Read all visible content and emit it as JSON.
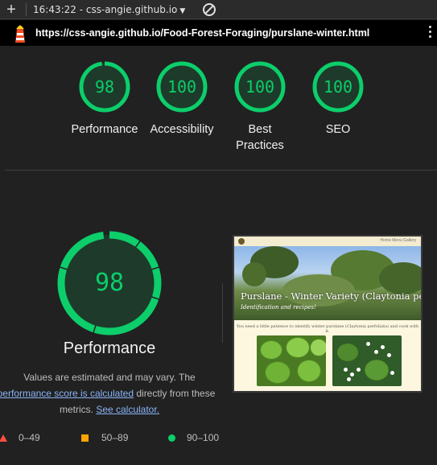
{
  "toolbar": {
    "time": "16:43:22 - css-angie.github.io",
    "caret": "▼"
  },
  "url": "https://css-angie.github.io/Food-Forest-Foraging/purslane-winter.html",
  "scores": [
    {
      "value": "98",
      "label": "Performance",
      "fraction": 0.98
    },
    {
      "value": "100",
      "label": "Accessibility",
      "fraction": 1.0
    },
    {
      "value": "100",
      "label": "Best Practices",
      "fraction": 1.0
    },
    {
      "value": "100",
      "label": "SEO",
      "fraction": 1.0
    }
  ],
  "performance": {
    "score": "98",
    "title": "Performance",
    "desc_line1": "Values are estimated and may vary. The",
    "link1": "performance score is calculated",
    "desc_line2_rest": " directly from these",
    "desc_line3_pre": "metrics. ",
    "link2": "See calculator."
  },
  "legend": {
    "fail": "0–49",
    "average": "50–89",
    "pass": "90–100"
  },
  "thumbnail": {
    "nav_links": "Home  Menu  Gallery",
    "title": "Purslane - Winter Variety (Claytonia perfoliata)",
    "subtitle": "Identification and recipes!",
    "text": "You need a little patience to identify winter purslane (Claytonia perfoliata) and cook with it."
  },
  "colors": {
    "pass": "#0cce6b",
    "average": "#ffa400",
    "fail": "#ff4e42",
    "background": "#212121"
  }
}
